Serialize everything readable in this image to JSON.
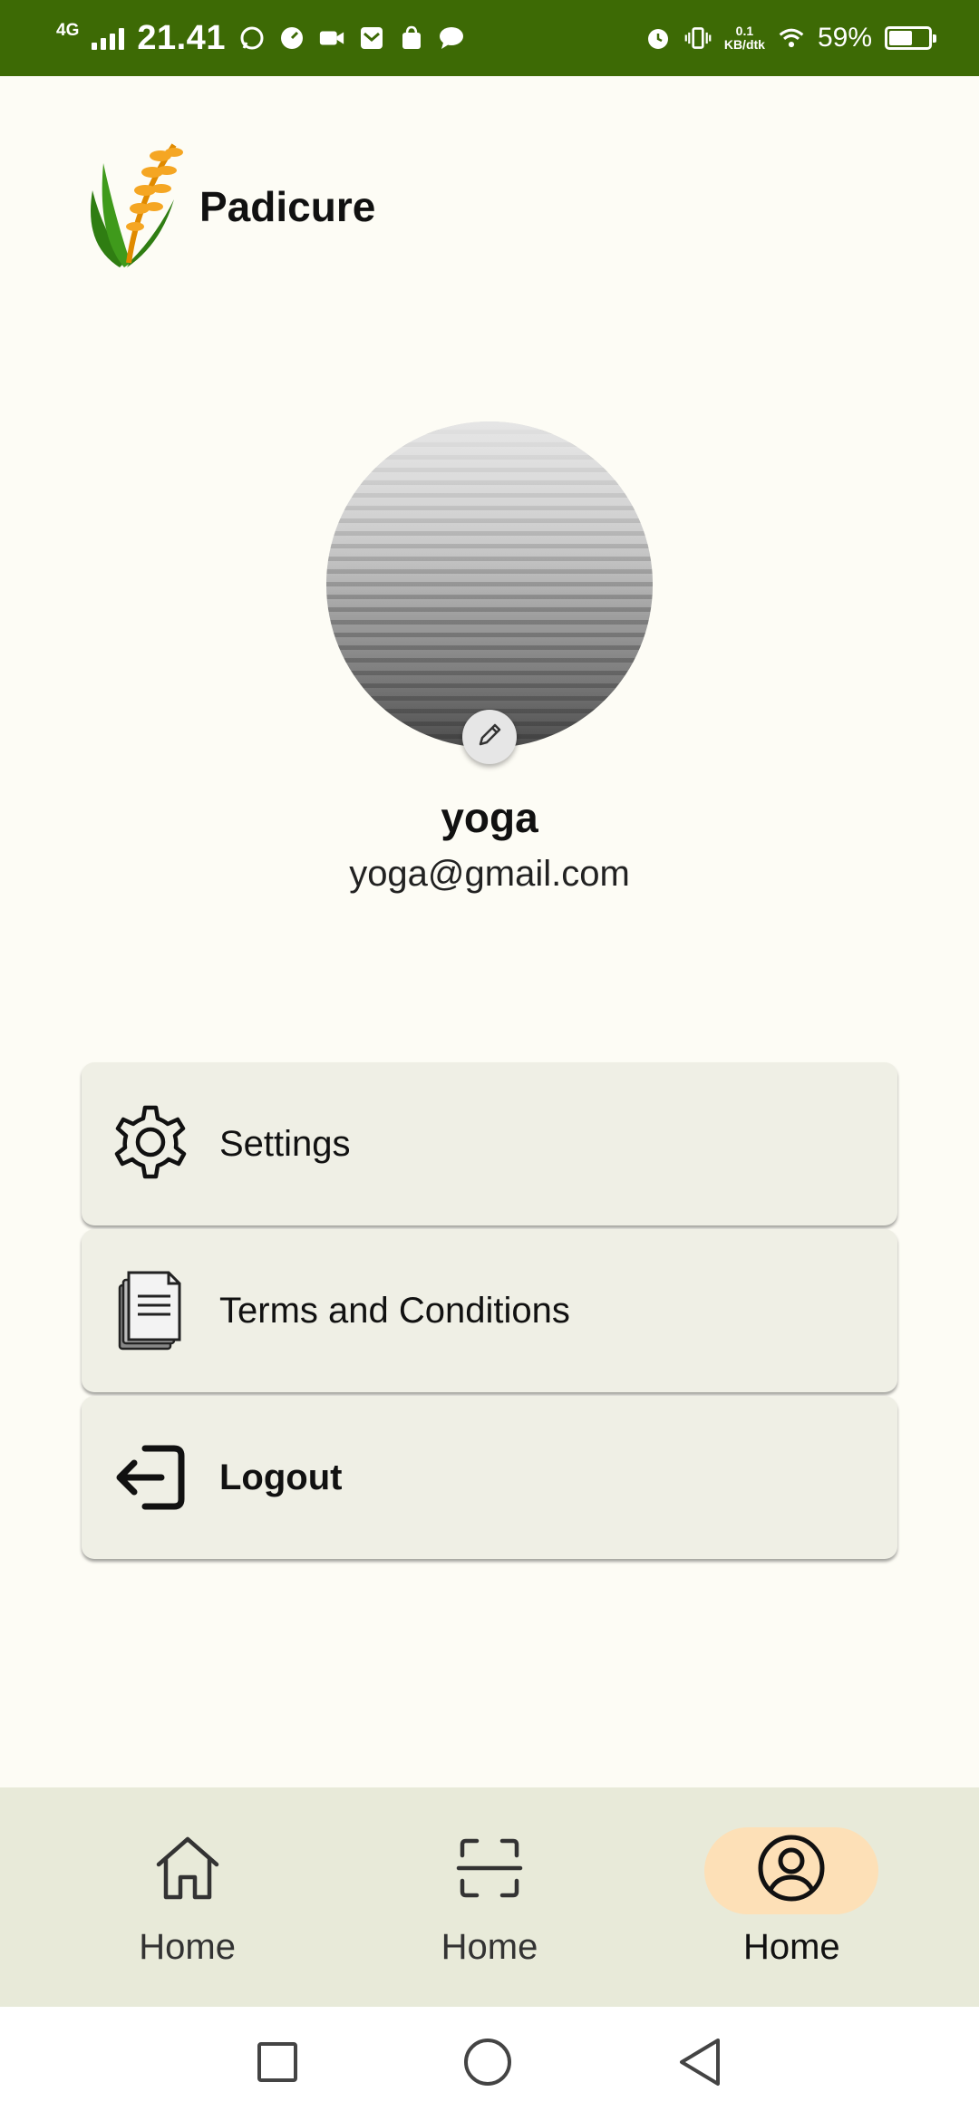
{
  "status_bar": {
    "network": "4G",
    "time": "21.41",
    "speed_value": "0.1",
    "speed_unit": "KB/dtk",
    "battery_percent": "59%",
    "battery_level": 0.59,
    "icons": [
      "whatsapp-icon",
      "speed-icon",
      "video-icon",
      "mail-icon",
      "shop-icon",
      "chat-icon",
      "alarm-icon",
      "vibrate-icon",
      "wifi-icon",
      "battery-icon"
    ]
  },
  "app": {
    "title": "Padicure",
    "logo_icon": "rice-plant-icon"
  },
  "profile": {
    "name": "yoga",
    "email": "yoga@gmail.com",
    "edit_icon": "pencil-icon"
  },
  "menu": {
    "items": [
      {
        "label": "Settings",
        "icon": "gear-icon"
      },
      {
        "label": "Terms and Conditions",
        "icon": "document-icon"
      },
      {
        "label": "Logout",
        "icon": "logout-icon"
      }
    ]
  },
  "bottom_nav": {
    "items": [
      {
        "label": "Home",
        "icon": "home-icon",
        "active": false
      },
      {
        "label": "Home",
        "icon": "scan-icon",
        "active": false
      },
      {
        "label": "Home",
        "icon": "profile-icon",
        "active": true
      }
    ],
    "active_color": "#fde0b7"
  },
  "colors": {
    "status_bar": "#3d6a05",
    "background": "#fdfcf5",
    "card": "#efefe5",
    "nav_bar": "#e8ead9"
  }
}
